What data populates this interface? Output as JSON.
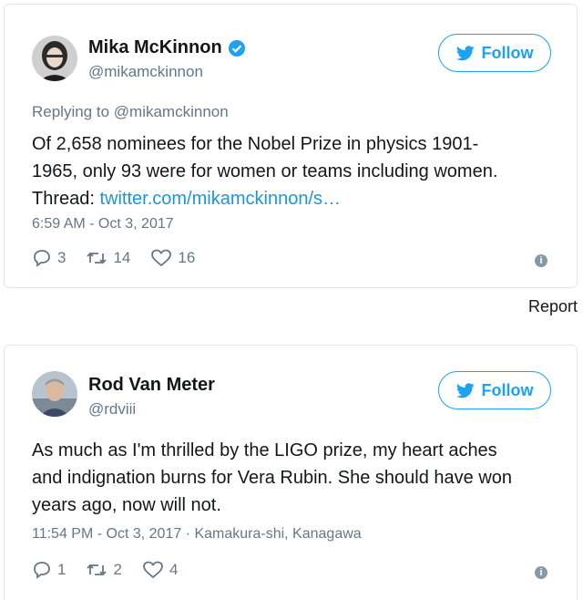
{
  "tweets": [
    {
      "name": "Mika McKinnon",
      "verified": true,
      "handle": "@mikamckinnon",
      "follow_label": "Follow",
      "replying_to": "Replying to @mikamckinnon",
      "text_line1": "Of 2,658 nominees for the Nobel Prize in physics 1901-",
      "text_line2": "1965, only 93 were for women or teams including women.",
      "text_line3_prefix": "Thread: ",
      "link_text": "twitter.com/mikamckinnon/s…",
      "timestamp": "6:59 AM - Oct 3, 2017",
      "replies": "3",
      "retweets": "14",
      "likes": "16"
    },
    {
      "name": "Rod Van Meter",
      "verified": false,
      "handle": "@rdviii",
      "follow_label": "Follow",
      "text_line1": "As much as I'm thrilled by the LIGO prize, my heart aches",
      "text_line2": "and indignation burns for Vera Rubin. She should have won",
      "text_line3": "years ago, now will not.",
      "timestamp": "11:54 PM - Oct 3, 2017",
      "location": "· Kamakura-shi, Kanagawa",
      "replies": "1",
      "retweets": "2",
      "likes": "4"
    }
  ],
  "report_label": "Report",
  "colors": {
    "accent": "#1da1f2",
    "link": "#1b95e0",
    "muted": "#657786",
    "border": "#e1e8ed"
  }
}
